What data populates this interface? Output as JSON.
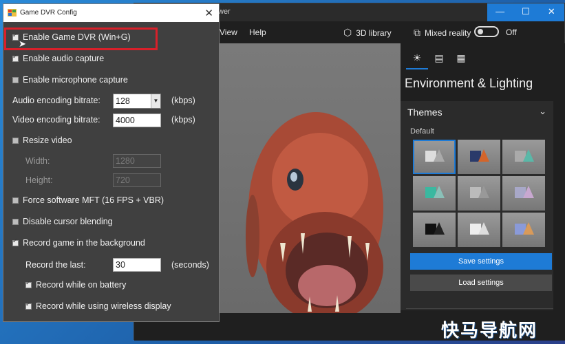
{
  "viewer": {
    "title": "wer",
    "controls": {
      "minimize": "—",
      "maximize": "☐",
      "close": "✕"
    },
    "menu": {
      "view": "View",
      "help": "Help"
    },
    "toolbar": {
      "library_label": "3D library",
      "mixed_reality_label": "Mixed reality",
      "toggle_state": "Off"
    },
    "panel": {
      "title": "Environment & Lighting",
      "themes_label": "Themes",
      "default_label": "Default",
      "save_label": "Save settings",
      "load_label": "Load settings"
    }
  },
  "dvr": {
    "title": "Game DVR Config",
    "close": "✕",
    "enable_dvr": "Enable Game DVR (Win+G)",
    "enable_audio": "Enable audio capture",
    "enable_mic": "Enable microphone capture",
    "audio_bitrate_label": "Audio encoding bitrate:",
    "audio_bitrate_value": "128",
    "audio_unit": "(kbps)",
    "video_bitrate_label": "Video encoding bitrate:",
    "video_bitrate_value": "4000",
    "video_unit": "(kbps)",
    "resize_label": "Resize video",
    "width_label": "Width:",
    "width_value": "1280",
    "height_label": "Height:",
    "height_value": "720",
    "force_mft": "Force software MFT (16 FPS + VBR)",
    "disable_cursor": "Disable cursor blending",
    "record_bg": "Record game in the background",
    "record_last_label": "Record the last:",
    "record_last_value": "30",
    "record_last_unit": "(seconds)",
    "record_battery": "Record while on battery",
    "record_wireless": "Record while using wireless display"
  },
  "watermark": "快马导航网"
}
